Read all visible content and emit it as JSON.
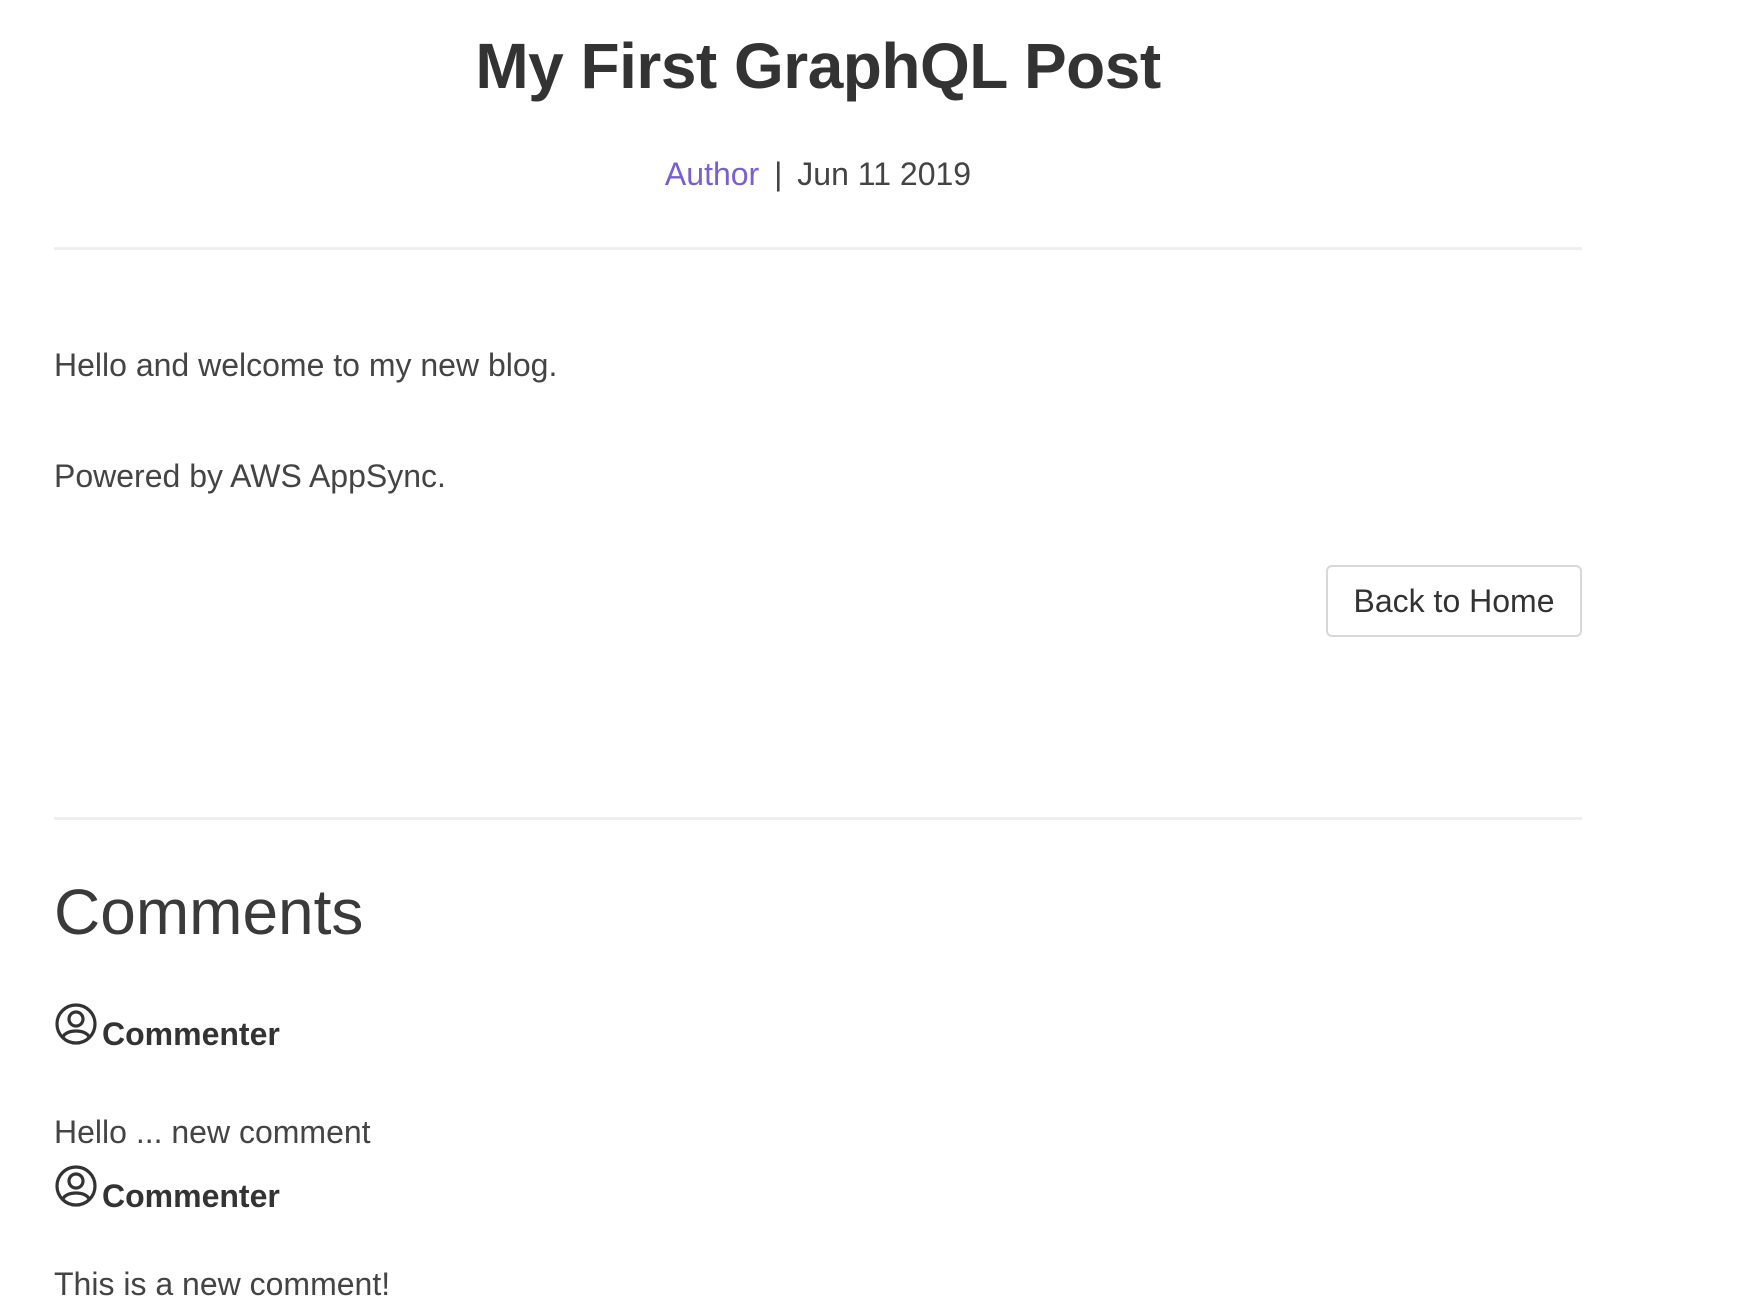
{
  "post": {
    "title": "My First GraphQL Post",
    "author": "Author",
    "separator": "|",
    "date": "Jun 11 2019",
    "body": [
      "Hello and welcome to my new blog.",
      "Powered by AWS AppSync."
    ],
    "back_button_label": "Back to Home"
  },
  "comments": {
    "heading": "Comments",
    "items": [
      {
        "author": "Commenter",
        "avatar_icon": "user-circle-icon",
        "text": "Hello ... new comment"
      },
      {
        "author": "Commenter",
        "avatar_icon": "user-circle-icon",
        "text": "This is a new comment!"
      }
    ]
  },
  "colors": {
    "accent": "#7a5fd0",
    "text": "#333333",
    "divider": "#efefef"
  }
}
